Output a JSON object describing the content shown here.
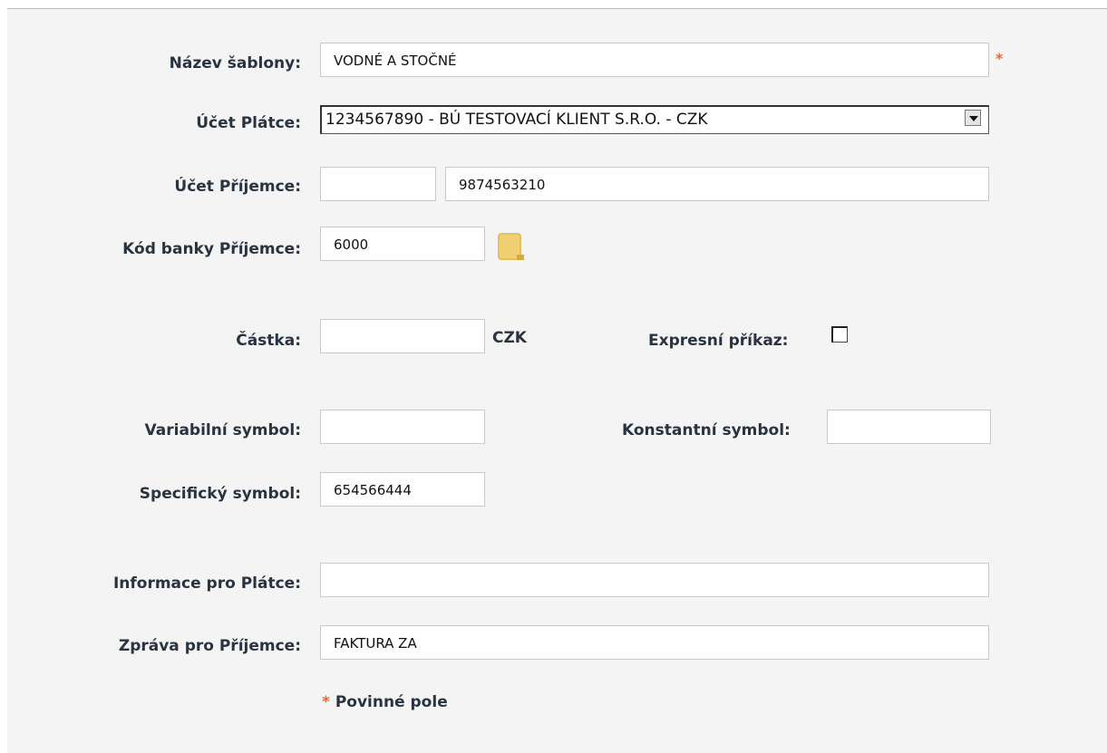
{
  "form": {
    "template_name": {
      "label": "Název šablony:",
      "value": "VODNÉ A STOČNÉ",
      "required_mark": "*"
    },
    "payer_account": {
      "label": "Účet Plátce:",
      "selected": "1234567890 - BÚ TESTOVACÍ KLIENT S.R.O. - CZK"
    },
    "recipient_account": {
      "label": "Účet Příjemce:",
      "prefix": "",
      "number": "9874563210"
    },
    "recipient_bank_code": {
      "label": "Kód banky Příjemce:",
      "value": "6000",
      "lookup_icon": "folder-icon"
    },
    "amount": {
      "label": "Částka:",
      "value": "",
      "currency": "CZK"
    },
    "express_order": {
      "label": "Expresní příkaz:",
      "checked": false
    },
    "variable_symbol": {
      "label": "Variabilní symbol:",
      "value": ""
    },
    "constant_symbol": {
      "label": "Konstantní symbol:",
      "value": ""
    },
    "specific_symbol": {
      "label": "Specifický symbol:",
      "value": "654566444"
    },
    "info_for_payer": {
      "label": "Informace pro Plátce:",
      "value": ""
    },
    "message_for_recipient": {
      "label": "Zpráva pro Příjemce:",
      "value": "FAKTURA ZA"
    },
    "required_note": {
      "mark": "*",
      "text": "Povinné pole"
    }
  },
  "colors": {
    "required": "#e86a2a",
    "panel_bg": "#f4f4f4",
    "label": "#2a3340"
  }
}
